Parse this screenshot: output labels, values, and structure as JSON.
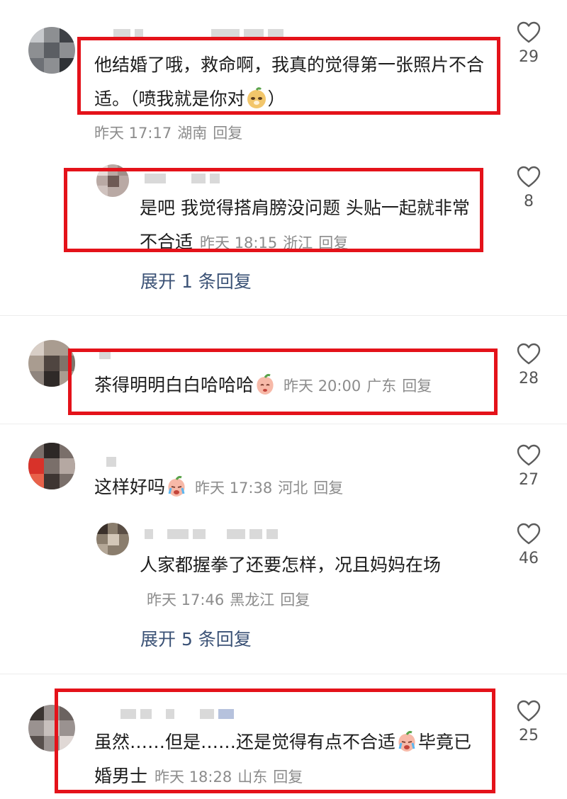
{
  "comments": [
    {
      "text": "他结婚了哦，救命啊，我真的觉得第一张照片不合适。（喷我就是你对",
      "text_tail": "）",
      "emoji": "doge-face-icon",
      "time": "昨天 17:17",
      "location": "湖南",
      "reply": "回复",
      "likes": "29"
    },
    {
      "text": "是吧  我觉得搭肩膀没问题  头贴一起就非常不合适",
      "time": "昨天 18:15",
      "location": "浙江",
      "reply": "回复",
      "likes": "8"
    },
    {
      "text": "茶得明明白白哈哈哈",
      "emoji": "shy-peach-icon",
      "time": "昨天 20:00",
      "location": "广东",
      "reply": "回复",
      "likes": "28"
    },
    {
      "text": "这样好吗",
      "emoji": "crying-peach-icon",
      "time": "昨天 17:38",
      "location": "河北",
      "reply": "回复",
      "likes": "27"
    },
    {
      "text": "人家都握拳了还要怎样，况且妈妈在场",
      "time": "昨天 17:46",
      "location": "黑龙江",
      "reply": "回复",
      "likes": "46"
    },
    {
      "text": "虽然……但是……还是觉得有点不合适",
      "text_tail": "毕竟已婚男士",
      "emoji": "crying-peach-icon",
      "time": "昨天 18:28",
      "location": "山东",
      "reply": "回复",
      "likes": "25"
    }
  ],
  "expand_1": "展开 1 条回复",
  "expand_2": "展开 5 条回复",
  "colors": {
    "highlight": "#e4121a",
    "meta": "#8c8c8c",
    "link": "#3b5276"
  }
}
